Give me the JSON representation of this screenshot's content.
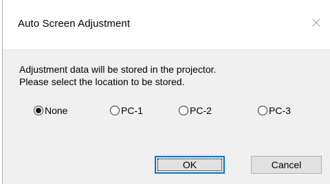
{
  "dialog": {
    "title": "Auto Screen Adjustment",
    "message_line1": "Adjustment data will be stored in the projector.",
    "message_line2": "Please select the location to be stored.",
    "options": [
      {
        "label": "None",
        "selected": true
      },
      {
        "label": "PC-1",
        "selected": false
      },
      {
        "label": "PC-2",
        "selected": false
      },
      {
        "label": "PC-3",
        "selected": false
      }
    ],
    "ok_label": "OK",
    "cancel_label": "Cancel"
  },
  "icons": {
    "close": "close-icon"
  },
  "colors": {
    "focus_border": "#0078d7",
    "content_background": "#f0f0f0",
    "button_background": "#e1e1e1"
  }
}
